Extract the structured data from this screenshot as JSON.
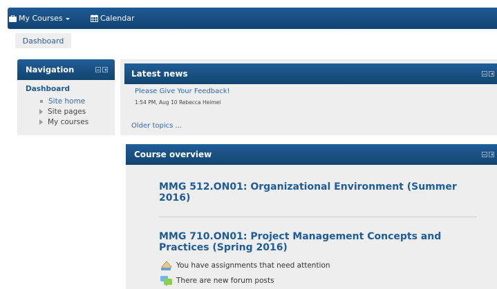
{
  "topbar": {
    "my_courses": "My Courses",
    "calendar": "Calendar"
  },
  "breadcrumb": {
    "dashboard": "Dashboard"
  },
  "navigation": {
    "title": "Navigation",
    "root": "Dashboard",
    "items": [
      {
        "label": "Site home",
        "icon": "square-bullet"
      },
      {
        "label": "Site pages",
        "icon": "expand-arrow"
      },
      {
        "label": "My courses",
        "icon": "expand-arrow"
      }
    ]
  },
  "latest_news": {
    "title": "Latest news",
    "post_title": "Please Give Your Feedback!",
    "post_meta": "1:54 PM, Aug 10  Rebecca Heimel",
    "older": "Older topics ..."
  },
  "course_overview": {
    "title": "Course overview",
    "courses": [
      {
        "name": "MMG 512.ON01: Organizational Environment (Summer 2016)"
      },
      {
        "name": "MMG 710.ON01: Project Management Concepts and Practices (Spring 2016)"
      }
    ],
    "alerts": [
      {
        "text": "You have assignments that need attention",
        "icon": "assignment-icon"
      },
      {
        "text": "There are new forum posts",
        "icon": "forum-icon"
      }
    ]
  },
  "colors": {
    "header_blue": "#1a5189",
    "link_blue": "#2a6bb0",
    "block_bg": "#eeeeee"
  }
}
